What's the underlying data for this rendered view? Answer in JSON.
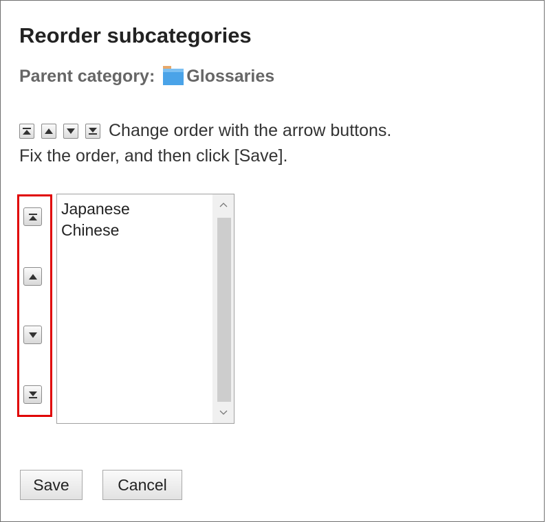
{
  "dialog": {
    "title": "Reorder subcategories",
    "parent_label": "Parent category:",
    "parent_name": "Glossaries",
    "instruction_line1": "Change order with the arrow buttons.",
    "instruction_line2": "Fix the order, and then click [Save]."
  },
  "subcategories": [
    "Japanese",
    "Chinese"
  ],
  "buttons": {
    "save": "Save",
    "cancel": "Cancel"
  },
  "colors": {
    "highlight": "#e00000",
    "folder": "#4aa3e8",
    "folder_tab": "#e8a86a"
  },
  "icons": [
    "move-to-top-icon",
    "move-up-icon",
    "move-down-icon",
    "move-to-bottom-icon",
    "folder-icon"
  ]
}
